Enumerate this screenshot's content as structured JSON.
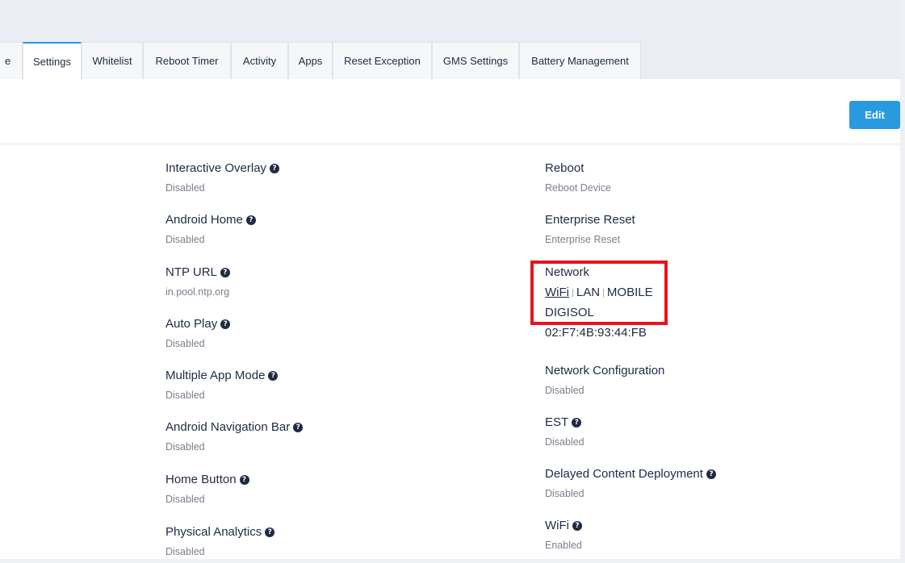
{
  "tabs": [
    {
      "label": "e"
    },
    {
      "label": "Settings",
      "active": true
    },
    {
      "label": "Whitelist"
    },
    {
      "label": "Reboot Timer"
    },
    {
      "label": "Activity"
    },
    {
      "label": "Apps"
    },
    {
      "label": "Reset Exception"
    },
    {
      "label": "GMS Settings"
    },
    {
      "label": "Battery Management"
    }
  ],
  "edit_label": "Edit",
  "left_fields": [
    {
      "label": "Interactive Overlay",
      "value": "Disabled",
      "help_icon": "question-circle-icon"
    },
    {
      "label": "Android Home",
      "value": "Disabled",
      "help_icon": "question-circle-icon"
    },
    {
      "label": "NTP URL",
      "value": "in.pool.ntp.org",
      "help_icon": "question-circle-icon"
    },
    {
      "label": "Auto Play",
      "value": "Disabled",
      "help_icon": "question-circle-icon"
    },
    {
      "label": "Multiple App Mode",
      "value": "Disabled",
      "help_icon": "question-circle-icon"
    },
    {
      "label": "Android Navigation Bar",
      "value": "Disabled",
      "help_icon": "question-circle-icon"
    },
    {
      "label": "Home Button",
      "value": "Disabled",
      "help_icon": "question-circle-icon"
    },
    {
      "label": "Physical Analytics",
      "value": "Disabled",
      "help_icon": "question-circle-icon"
    }
  ],
  "right_fields": {
    "reboot": {
      "label": "Reboot",
      "value": "Reboot Device"
    },
    "enterprise_reset": {
      "label": "Enterprise Reset",
      "value": "Enterprise Reset"
    },
    "network": {
      "label": "Network",
      "options": [
        "WiFi",
        "LAN",
        "MOBILE"
      ],
      "selected": "WiFi",
      "separator": "|",
      "ssid": "DIGISOL",
      "mac": "02:F7:4B:93:44:FB"
    },
    "network_configuration": {
      "label": "Network Configuration",
      "value": "Disabled"
    },
    "est": {
      "label": "EST",
      "value": "Disabled"
    },
    "delayed_content": {
      "label": "Delayed Content Deployment",
      "value": "Disabled"
    },
    "wifi": {
      "label": "WiFi",
      "value": "Enabled"
    }
  },
  "help_glyph": "?",
  "colors": {
    "accent": "#2a9ae0",
    "highlight": "#e8141b",
    "text": "#1f2a44",
    "muted": "#7a808c"
  }
}
